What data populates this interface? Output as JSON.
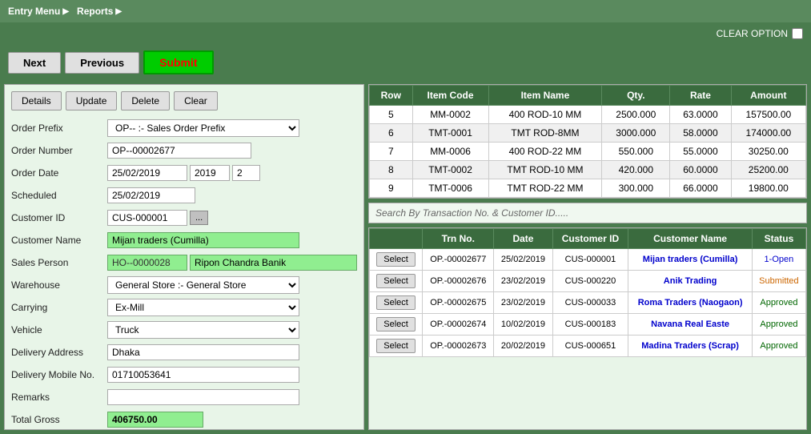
{
  "menu": {
    "items": [
      {
        "label": "Entry Menu",
        "arrow": "▶"
      },
      {
        "label": "Reports",
        "arrow": "▶"
      }
    ]
  },
  "clear_option": {
    "label": "CLEAR OPTION"
  },
  "nav": {
    "next_label": "Next",
    "previous_label": "Previous",
    "submit_label": "Submit"
  },
  "action_buttons": {
    "details": "Details",
    "update": "Update",
    "delete": "Delete",
    "clear": "Clear"
  },
  "form": {
    "order_prefix_label": "Order Prefix",
    "order_prefix_value": "OP-- :- Sales Order Prefix",
    "order_number_label": "Order Number",
    "order_number_value": "OP--00002677",
    "order_date_label": "Order Date",
    "order_date_value": "25/02/2019",
    "order_year": "2019",
    "order_seq": "2",
    "scheduled_label": "Scheduled",
    "scheduled_value": "25/02/2019",
    "customer_id_label": "Customer ID",
    "customer_id_value": "CUS-000001",
    "customer_name_label": "Customer Name",
    "customer_name_value": "Mijan traders  (Cumilla)",
    "sales_person_label": "Sales Person",
    "sales_person_code": "HO--0000028",
    "sales_person_name": "Ripon Chandra Banik",
    "warehouse_label": "Warehouse",
    "warehouse_value": "General Store :- General Store",
    "carrying_label": "Carrying",
    "carrying_value": "Ex-Mill",
    "vehicle_label": "Vehicle",
    "vehicle_value": "Truck",
    "delivery_address_label": "Delivery Address",
    "delivery_address_value": "Dhaka",
    "delivery_mobile_label": "Delivery Mobile No.",
    "delivery_mobile_value": "01710053641",
    "remarks_label": "Remarks",
    "remarks_value": "",
    "total_gross_label": "Total Gross",
    "total_gross_value": "406750.00"
  },
  "top_table": {
    "headers": [
      "Row",
      "Item Code",
      "Item Name",
      "Qty.",
      "Rate",
      "Amount"
    ],
    "rows": [
      {
        "row": "5",
        "item_code": "MM-0002",
        "item_name": "400 ROD-10 MM",
        "qty": "2500.000",
        "rate": "63.0000",
        "amount": "157500.00"
      },
      {
        "row": "6",
        "item_code": "TMT-0001",
        "item_name": "TMT ROD-8MM",
        "qty": "3000.000",
        "rate": "58.0000",
        "amount": "174000.00"
      },
      {
        "row": "7",
        "item_code": "MM-0006",
        "item_name": "400 ROD-22 MM",
        "qty": "550.000",
        "rate": "55.0000",
        "amount": "30250.00"
      },
      {
        "row": "8",
        "item_code": "TMT-0002",
        "item_name": "TMT ROD-10 MM",
        "qty": "420.000",
        "rate": "60.0000",
        "amount": "25200.00"
      },
      {
        "row": "9",
        "item_code": "TMT-0006",
        "item_name": "TMT ROD-22 MM",
        "qty": "300.000",
        "rate": "66.0000",
        "amount": "19800.00"
      }
    ]
  },
  "search_bar": {
    "placeholder": "Search By Transaction No. & Customer ID....."
  },
  "bottom_table": {
    "headers": [
      "",
      "Trn No.",
      "Date",
      "Customer ID",
      "Customer Name",
      "Status"
    ],
    "rows": [
      {
        "trn": "OP.-00002677",
        "date": "25/02/2019",
        "cust_id": "CUS-000001",
        "cust_name": "Mijan traders (Cumilla)",
        "status": "1-Open",
        "status_class": "status-open"
      },
      {
        "trn": "OP.-00002676",
        "date": "23/02/2019",
        "cust_id": "CUS-000220",
        "cust_name": "Anik Trading",
        "status": "Submitted",
        "status_class": "status-submitted"
      },
      {
        "trn": "OP.-00002675",
        "date": "23/02/2019",
        "cust_id": "CUS-000033",
        "cust_name": "Roma Traders (Naogaon)",
        "status": "Approved",
        "status_class": "status-approved"
      },
      {
        "trn": "OP.-00002674",
        "date": "10/02/2019",
        "cust_id": "CUS-000183",
        "cust_name": "Navana Real Easte",
        "status": "Approved",
        "status_class": "status-approved"
      },
      {
        "trn": "OP.-00002673",
        "date": "20/02/2019",
        "cust_id": "CUS-000651",
        "cust_name": "Madina Traders (Scrap)",
        "status": "Approved",
        "status_class": "status-approved"
      }
    ],
    "select_label": "Select"
  }
}
